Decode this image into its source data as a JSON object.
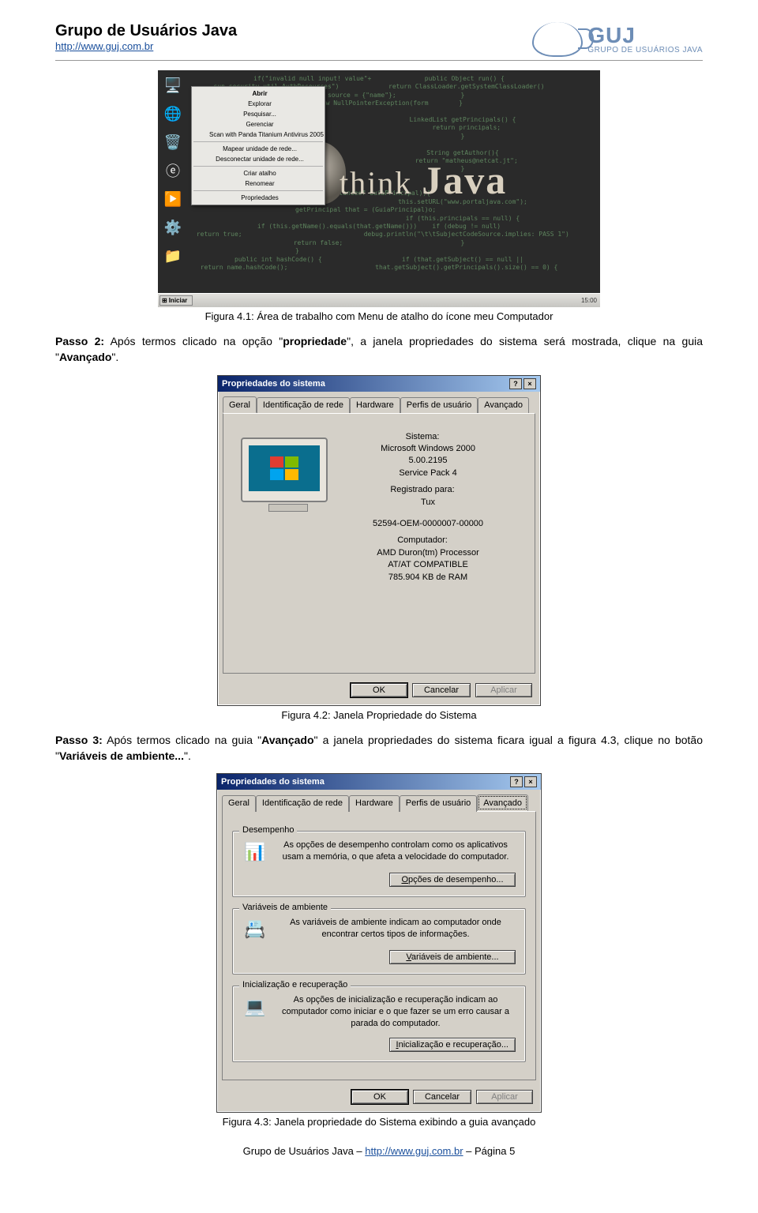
{
  "header": {
    "title": "Grupo de Usuários Java",
    "url": "http://www.guj.com.br",
    "logo_big": "GUJ",
    "logo_small": "GRUPO DE USUÁRIOS JAVA"
  },
  "fig41": {
    "caption": "Figura 4.1: Área de trabalho com Menu de atalho do ícone meu Computador",
    "think_label": "think",
    "java_label": "Java",
    "ctx_items": [
      "Abrir",
      "Explorar",
      "Pesquisar...",
      "Gerenciar",
      "Scan with Panda Titanium Antivirus 2005",
      "Mapear unidade de rede...",
      "Desconectar unidade de rede...",
      "Criar atalho",
      "Renomear",
      "Propriedades"
    ],
    "taskbar_start": "Iniciar",
    "taskbar_time": "15:00"
  },
  "passo2": {
    "label": "Passo 2:",
    "text_a": " Após termos clicado na opção \"",
    "kw1": "propriedade",
    "text_b": "\", a janela propriedades do sistema será mostrada, clique na guia \"",
    "kw2": "Avançado",
    "text_c": "\"."
  },
  "fig42": {
    "caption": "Figura 4.2: Janela Propriedade do Sistema",
    "title": "Propriedades do sistema",
    "tabs": [
      "Geral",
      "Identificação de rede",
      "Hardware",
      "Perfis de usuário",
      "Avançado"
    ],
    "sistema_lbl": "Sistema:",
    "sistema_v1": "Microsoft Windows 2000",
    "sistema_v2": "5.00.2195",
    "sistema_v3": "Service Pack 4",
    "reg_lbl": "Registrado para:",
    "reg_v1": "Tux",
    "reg_v2": "52594-OEM-0000007-00000",
    "comp_lbl": "Computador:",
    "comp_v1": "AMD Duron(tm) Processor",
    "comp_v2": "AT/AT COMPATIBLE",
    "comp_v3": "785.904 KB de RAM",
    "ok": "OK",
    "cancel": "Cancelar",
    "apply": "Aplicar"
  },
  "passo3": {
    "label": "Passo 3:",
    "text_a": " Após termos clicado na guia \"",
    "kw1": "Avançado",
    "text_b": "\" a janela propriedades do sistema ficara igual a figura 4.3, clique no botão \"",
    "kw2": "Variáveis de ambiente...",
    "text_c": "\"."
  },
  "fig43": {
    "caption": "Figura 4.3: Janela propriedade do Sistema exibindo a guia avançado",
    "title": "Propriedades do sistema",
    "tabs": [
      "Geral",
      "Identificação de rede",
      "Hardware",
      "Perfis de usuário",
      "Avançado"
    ],
    "g1_legend": "Desempenho",
    "g1_desc": "As opções de desempenho controlam como os aplicativos usam a memória, o que afeta a velocidade do computador.",
    "g1_btn_u": "O",
    "g1_btn_rest": "pções de desempenho...",
    "g2_legend": "Variáveis de ambiente",
    "g2_desc": "As variáveis de ambiente indicam ao computador onde encontrar certos tipos de informações.",
    "g2_btn_u": "V",
    "g2_btn_rest": "ariáveis de ambiente...",
    "g3_legend": "Inicialização e recuperação",
    "g3_desc": "As opções de inicialização e recuperação indicam ao computador como iniciar e o que fazer se um erro causar a parada do computador.",
    "g3_btn_u": "I",
    "g3_btn_rest": "nicialização e recuperação...",
    "ok": "OK",
    "cancel": "Cancelar",
    "apply": "Aplicar"
  },
  "footer": {
    "text_a": "Grupo de Usuários Java – ",
    "url": "http://www.guj.com.br",
    "text_b": " – Página 5"
  }
}
